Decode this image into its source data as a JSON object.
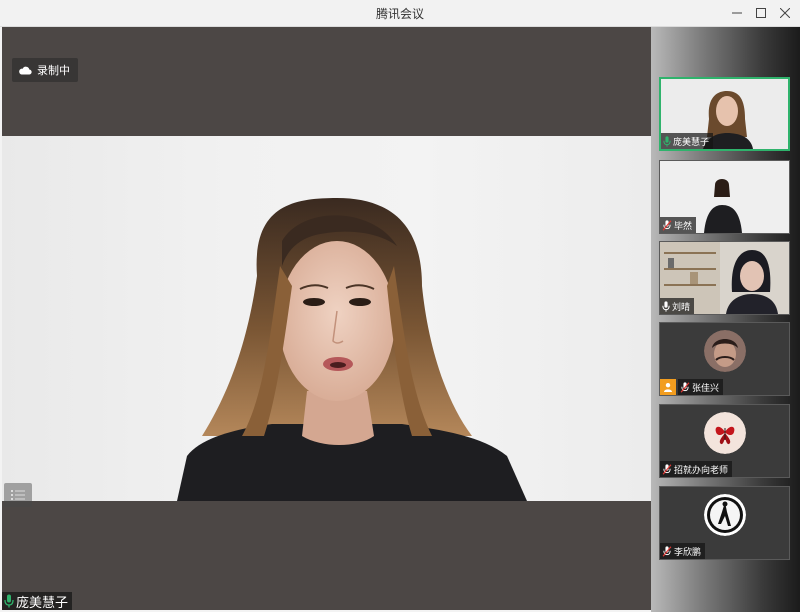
{
  "window": {
    "title": "腾讯会议"
  },
  "main": {
    "recording_label": "录制中",
    "speaker_name": "庞美慧子"
  },
  "participants": [
    {
      "name": "庞美慧子",
      "mic": "on",
      "active": true,
      "video": true
    },
    {
      "name": "毕然",
      "mic": "muted",
      "active": false,
      "video": true
    },
    {
      "name": "刘晴",
      "mic": "on",
      "active": false,
      "video": true
    },
    {
      "name": "张佳兴",
      "mic": "muted",
      "active": false,
      "video": false,
      "host": true
    },
    {
      "name": "招就办向老师",
      "mic": "muted",
      "active": false,
      "video": false
    },
    {
      "name": "李欣鹏",
      "mic": "muted",
      "active": false,
      "video": false
    }
  ],
  "icons": {
    "minimize": "minimize-icon",
    "maximize": "maximize-icon",
    "close": "close-icon",
    "cloud": "cloud-icon",
    "list": "list-icon",
    "mic_on": "mic-icon",
    "mic_muted": "mic-muted-icon",
    "host": "host-icon"
  },
  "colors": {
    "active_border": "#2fb36c",
    "mic_green": "#2fb36c",
    "mute_red": "#e53935",
    "host_orange": "#f29d1f"
  }
}
